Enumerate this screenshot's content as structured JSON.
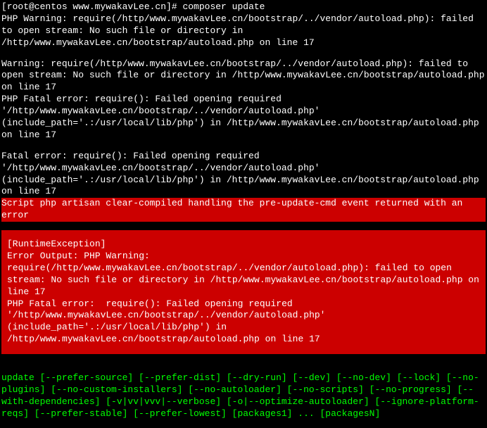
{
  "prompt": "[root@centos www.mywakavLee.cn]# ",
  "command": "composer update",
  "output": {
    "warning1": "PHP Warning:  require(/http/www.mywakavLee.cn/bootstrap/../vendor/autoload.php): failed to open stream: No such file or directory in /http/www.mywakavLee.cn/bootstrap/autoload.php on line 17",
    "warning2": "Warning: require(/http/www.mywakavLee.cn/bootstrap/../vendor/autoload.php): failed to open stream: No such file or directory in /http/www.mywakavLee.cn/bootstrap/autoload.php on line 17",
    "fatal1": "PHP Fatal error:  require(): Failed opening required '/http/www.mywakavLee.cn/bootstrap/../vendor/autoload.php' (include_path='.:/usr/local/lib/php') in /http/www.mywakavLee.cn/bootstrap/autoload.php on line 17",
    "fatal2": "Fatal error: require(): Failed opening required '/http/www.mywakavLee.cn/bootstrap/../vendor/autoload.php' (include_path='.:/usr/local/lib/php') in /http/www.mywakavLee.cn/bootstrap/autoload.php on line 17"
  },
  "script_error": "Script php artisan clear-compiled handling the pre-update-cmd event returned with an error",
  "runtime_exception": {
    "title": "[RuntimeException]",
    "body": "Error Output: PHP Warning:  require(/http/www.mywakavLee.cn/bootstrap/../vendor/autoload.php): failed to open stream: No such file or directory in /http/www.mywakavLee.cn/bootstrap/autoload.php on line 17\nPHP Fatal error:  require(): Failed opening required '/http/www.mywakavLee.cn/bootstrap/../vendor/autoload.php' (include_path='.:/usr/local/lib/php') in /http/www.mywakavLee.cn/bootstrap/autoload.php on line 17"
  },
  "usage": "update [--prefer-source] [--prefer-dist] [--dry-run] [--dev] [--no-dev] [--lock] [--no-plugins] [--no-custom-installers] [--no-autoloader] [--no-scripts] [--no-progress] [--with-dependencies] [-v|vv|vvv|--verbose] [-o|--optimize-autoloader] [--ignore-platform-reqs] [--prefer-stable] [--prefer-lowest] [packages1] ... [packagesN]"
}
